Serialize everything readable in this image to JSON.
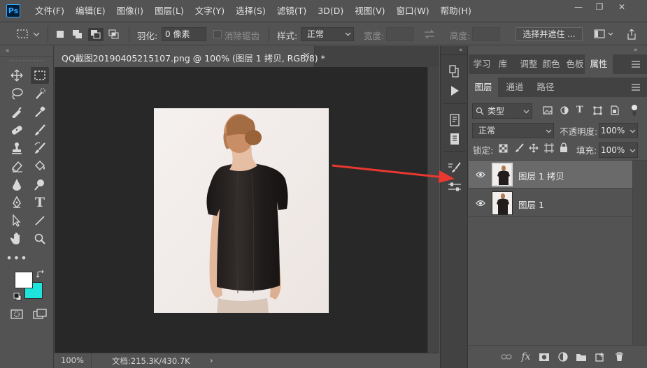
{
  "app": {
    "logo_text": "Ps",
    "menu": [
      "文件(F)",
      "编辑(E)",
      "图像(I)",
      "图层(L)",
      "文字(Y)",
      "选择(S)",
      "滤镜(T)",
      "3D(D)",
      "视图(V)",
      "窗口(W)",
      "帮助(H)"
    ],
    "window_controls": {
      "minimize": "—",
      "restore": "❐",
      "close": "✕"
    }
  },
  "options": {
    "feather_label": "羽化:",
    "feather_value": "0 像素",
    "antialias_label": "消除锯齿",
    "style_label": "样式:",
    "style_value": "正常",
    "width_label": "宽度:",
    "height_label": "高度:",
    "select_mask_button": "选择并遮住 ..."
  },
  "document": {
    "tab_title": "QQ截图20190405215107.png @ 100% (图层 1 拷贝, RGB/8) *",
    "tab_close": "×",
    "zoom": "100%",
    "doc_info": "文档:215.3K/430.7K",
    "status_arrow": "›"
  },
  "panels": {
    "top_tabs": [
      "学习",
      "库",
      "调整",
      "颜色",
      "色板",
      "属性"
    ],
    "top_active_index": 5,
    "layers_tabs": [
      "图层",
      "通道",
      "路径"
    ],
    "layers_active_index": 0,
    "filter_kind": "类型",
    "blend_mode": "正常",
    "opacity_label": "不透明度:",
    "opacity_value": "100%",
    "lock_label": "锁定:",
    "fill_label": "填充:",
    "fill_value": "100%",
    "layers": [
      {
        "name": "图层 1 拷贝",
        "selected": true
      },
      {
        "name": "图层 1",
        "selected": false
      }
    ],
    "footer_fx": "fx"
  },
  "colors": {
    "foreground": "#ffffff",
    "background": "#1de4dc",
    "annotation_arrow": "#e8382f"
  }
}
